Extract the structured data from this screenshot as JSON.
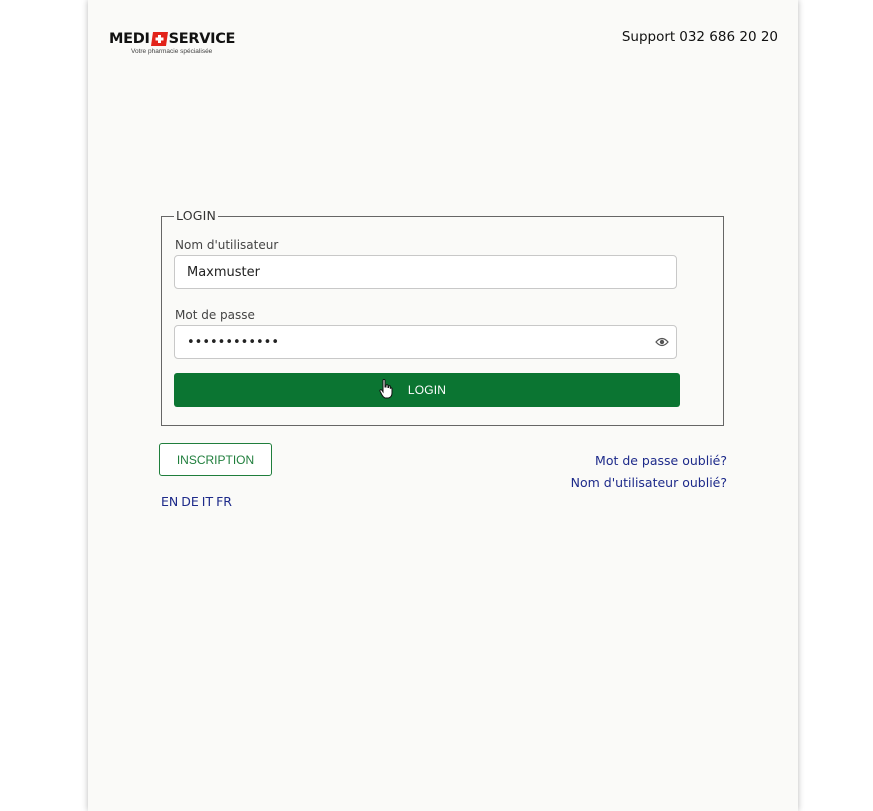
{
  "header": {
    "logo_left": "MEDI",
    "logo_right": "SERVICE",
    "logo_tagline": "Votre pharmacie spécialisée",
    "support_label": "Support",
    "support_phone": "032 686 20 20"
  },
  "login": {
    "legend": "LOGIN",
    "username_label": "Nom d'utilisateur",
    "username_value": "Maxmuster",
    "password_label": "Mot de passe",
    "password_value": "••••••••••••",
    "button_label": "LOGIN"
  },
  "actions": {
    "inscription_label": "INSCRIPTION",
    "forgot_password": "Mot de passe oublié?",
    "forgot_username": "Nom d'utilisateur oublié?"
  },
  "languages": [
    "EN",
    "DE",
    "IT",
    "FR"
  ],
  "colors": {
    "primary_green": "#0b7532",
    "link_blue": "#1d2a8a",
    "logo_red": "#e2231a"
  },
  "icons": {
    "password_toggle": "eye-icon",
    "cursor": "hand-pointer-icon"
  }
}
